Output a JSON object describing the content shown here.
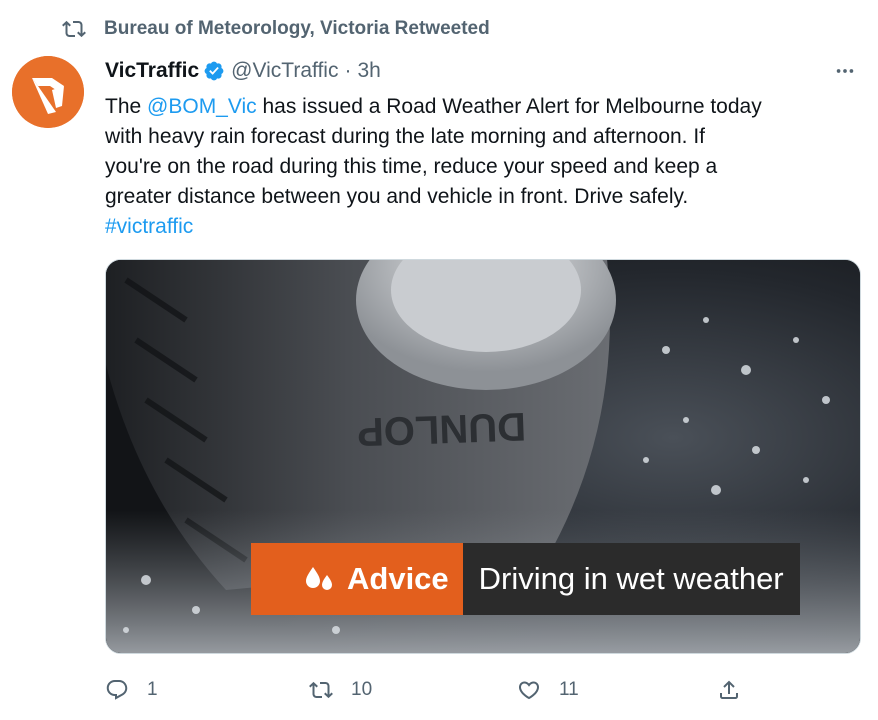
{
  "retweet": {
    "text": "Bureau of Meteorology, Victoria Retweeted",
    "icon": "retweet-icon"
  },
  "author": {
    "name": "VicTraffic",
    "handle": "@VicTraffic",
    "separator": "·",
    "time": "3h",
    "verified": true,
    "avatar_color": "#e8702a"
  },
  "tweet": {
    "lines": [
      {
        "pre": "The ",
        "mention": "@BOM_Vic",
        "post": " has issued a Road Weather Alert for Melbourne today"
      },
      {
        "text": "with heavy rain forecast during the late morning and afternoon. If"
      },
      {
        "text": "you're on the road during this time, reduce your speed and keep a"
      },
      {
        "text": "greater distance between you and vehicle in front. Drive safely."
      }
    ],
    "hashtag": "#victraffic"
  },
  "media": {
    "tyre_brand": "DUNLOP",
    "banner_label": "Advice",
    "banner_subtitle": "Driving in wet weather",
    "banner_color": "#e35f1d"
  },
  "actions": {
    "reply_count": "1",
    "retweet_count": "10",
    "like_count": "11"
  },
  "colors": {
    "link": "#1d9bf0",
    "secondary_text": "#536471",
    "primary_text": "#0f1419"
  }
}
